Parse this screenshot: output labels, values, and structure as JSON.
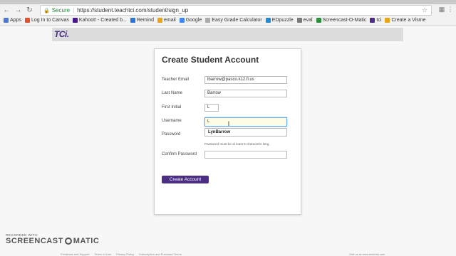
{
  "browser": {
    "back_icon": "back-arrow-icon",
    "forward_icon": "forward-arrow-icon",
    "reload_icon": "reload-icon",
    "secure_label": "Secure",
    "url": "https://student.teachtci.com/student/sign_up",
    "bookmarks": [
      {
        "label": "Apps",
        "color": "#4a7bd0"
      },
      {
        "label": "Log In to Canvas",
        "color": "#e1512d"
      },
      {
        "label": "Kahoot! - Created b...",
        "color": "#46178f"
      },
      {
        "label": "Remind",
        "color": "#2b74d8"
      },
      {
        "label": "email",
        "color": "#e8a317"
      },
      {
        "label": "Google",
        "color": "#4285f4"
      },
      {
        "label": "Easy Grade Calculator",
        "color": "#aaaaaa"
      },
      {
        "label": "EDpuzzle",
        "color": "#1f8bd0"
      },
      {
        "label": "eval",
        "color": "#7a7a7a"
      },
      {
        "label": "Screencast-O-Matic",
        "color": "#2d8e3e"
      },
      {
        "label": "tci",
        "color": "#4b2e83"
      },
      {
        "label": "Create a Visme",
        "color": "#e8a317"
      }
    ]
  },
  "header": {
    "logo": "TCi."
  },
  "form": {
    "title": "Create Student Account",
    "fields": {
      "teacher_email": {
        "label": "Teacher Email",
        "value": "lbarrow@pasco.k12.fl.us"
      },
      "last_name": {
        "label": "Last Name",
        "value": "Barrow"
      },
      "first_initial": {
        "label": "First Initial",
        "value": "L"
      },
      "username": {
        "label": "Username",
        "value": "L"
      },
      "password": {
        "label": "Password",
        "value": ""
      },
      "confirm_password": {
        "label": "Confirm Password",
        "value": ""
      }
    },
    "autocomplete_suggestion": "LynBarrow",
    "password_hint": "Password must be at least 6 characters long.",
    "submit_label": "Create Account"
  },
  "watermark": {
    "line1": "RECORDED WITH",
    "line2a": "SCREENCAST",
    "line2b": "MATIC"
  },
  "footer": {
    "links": [
      "Feedback and Support",
      "Terms of Use",
      "Privacy Policy",
      "Subscription and Purchase Terms"
    ],
    "right": "Visit us at www.teachtci.com"
  },
  "colors": {
    "brand": "#4b2e83",
    "secure": "#1a8a3a",
    "focus": "#6aa9e8"
  }
}
